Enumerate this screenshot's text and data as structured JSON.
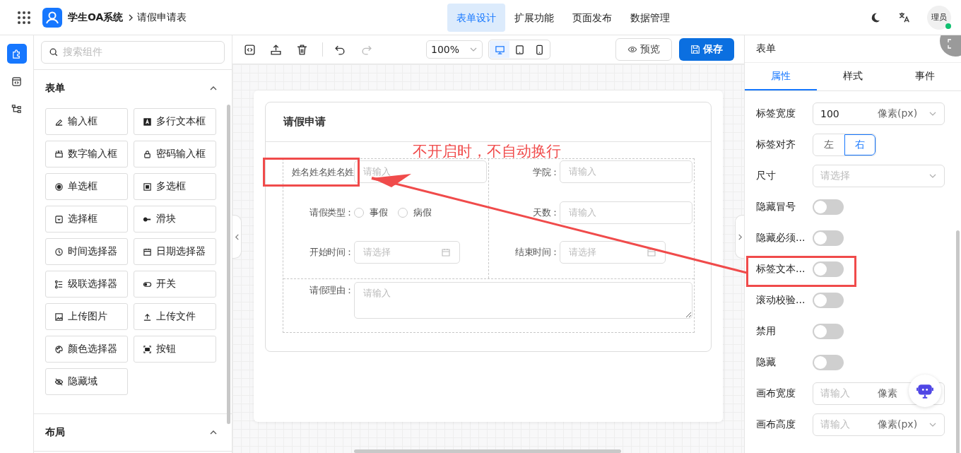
{
  "topbar": {
    "app_title": "学生OA系统",
    "breadcrumb": "请假申请表",
    "nav": [
      {
        "label": "表单设计",
        "selected": true
      },
      {
        "label": "扩展功能",
        "selected": false
      },
      {
        "label": "页面发布",
        "selected": false
      },
      {
        "label": "数据管理",
        "selected": false
      }
    ],
    "avatar": "理员",
    "online": true
  },
  "rail": [
    {
      "kind": "puzzle",
      "selected": true
    },
    {
      "kind": "code",
      "selected": false
    },
    {
      "kind": "tree",
      "selected": false
    }
  ],
  "components": {
    "search": {
      "placeholder": "搜索组件"
    },
    "sections": [
      {
        "title": "表单",
        "expanded": true,
        "items": [
          {
            "label": "输入框",
            "kind": "pen"
          },
          {
            "label": "多行文本框",
            "kind": "textarea"
          },
          {
            "label": "数字输入框",
            "kind": "number"
          },
          {
            "label": "密码输入框",
            "kind": "lock"
          },
          {
            "label": "单选框",
            "kind": "radio"
          },
          {
            "label": "多选框",
            "kind": "checkbox"
          },
          {
            "label": "选择框",
            "kind": "select"
          },
          {
            "label": "滑块",
            "kind": "slider"
          },
          {
            "label": "时间选择器",
            "kind": "clock"
          },
          {
            "label": "日期选择器",
            "kind": "calendar"
          },
          {
            "label": "级联选择器",
            "kind": "cascade"
          },
          {
            "label": "开关",
            "kind": "switch"
          },
          {
            "label": "上传图片",
            "kind": "image"
          },
          {
            "label": "上传文件",
            "kind": "upload"
          },
          {
            "label": "颜色选择器",
            "kind": "palette"
          },
          {
            "label": "按钮",
            "kind": "button"
          },
          {
            "label": "隐藏域",
            "kind": "eyeoff"
          }
        ]
      },
      {
        "title": "布局",
        "expanded": true
      }
    ]
  },
  "toolbar": {
    "zoom": "100%",
    "devices": [
      {
        "kind": "desktop",
        "selected": true
      },
      {
        "kind": "tablet",
        "selected": false
      },
      {
        "kind": "phone",
        "selected": false
      }
    ],
    "preview": "预览",
    "save": "保存"
  },
  "form": {
    "title": "请假申请",
    "left": [
      {
        "kind": "input",
        "label": "姓名姓名姓名姓",
        "placeholder": "请输入"
      },
      {
        "kind": "radio",
        "label": "请假类型：",
        "options": [
          {
            "label": "事假",
            "selected": false
          },
          {
            "label": "病假",
            "selected": false
          }
        ]
      },
      {
        "kind": "date",
        "label": "开始时间：",
        "placeholder": "请选择"
      }
    ],
    "right": [
      {
        "kind": "input",
        "label": "学院：",
        "placeholder": "请输入"
      },
      {
        "kind": "input",
        "label": "天数：",
        "placeholder": "请输入"
      },
      {
        "kind": "date",
        "label": "结束时间：",
        "placeholder": "请选择"
      }
    ],
    "bottom": [
      {
        "kind": "textarea",
        "label": "请假理由：",
        "placeholder": "请输入"
      }
    ]
  },
  "panel": {
    "title": "表单",
    "tabs": [
      {
        "label": "属性",
        "selected": true
      },
      {
        "label": "样式",
        "selected": false
      },
      {
        "label": "事件",
        "selected": false
      }
    ],
    "settings": [
      {
        "kind": "unit",
        "label": "标签宽度",
        "value": "100",
        "unit": "像素(px)"
      },
      {
        "kind": "segmented",
        "label": "标签对齐",
        "options": [
          {
            "label": "左",
            "selected": false
          },
          {
            "label": "右",
            "selected": true
          }
        ]
      },
      {
        "kind": "select",
        "label": "尺寸",
        "placeholder": "请选择"
      },
      {
        "kind": "switch",
        "label": "隐藏冒号",
        "on": false
      },
      {
        "kind": "switch",
        "label": "隐藏必须...",
        "on": false
      },
      {
        "kind": "switch",
        "label": "标签文本...",
        "on": false
      },
      {
        "kind": "switch",
        "label": "滚动校验...",
        "on": false
      },
      {
        "kind": "switch",
        "label": "禁用",
        "on": false
      },
      {
        "kind": "switch",
        "label": "隐藏",
        "on": false
      },
      {
        "kind": "unit",
        "label": "画布宽度",
        "placeholder": "请输入",
        "unit": "像素"
      },
      {
        "kind": "unit",
        "label": "画布高度",
        "placeholder": "请输入",
        "unit": "像素(px)"
      }
    ]
  },
  "annotation": {
    "text": "不开启时，不自动换行"
  }
}
